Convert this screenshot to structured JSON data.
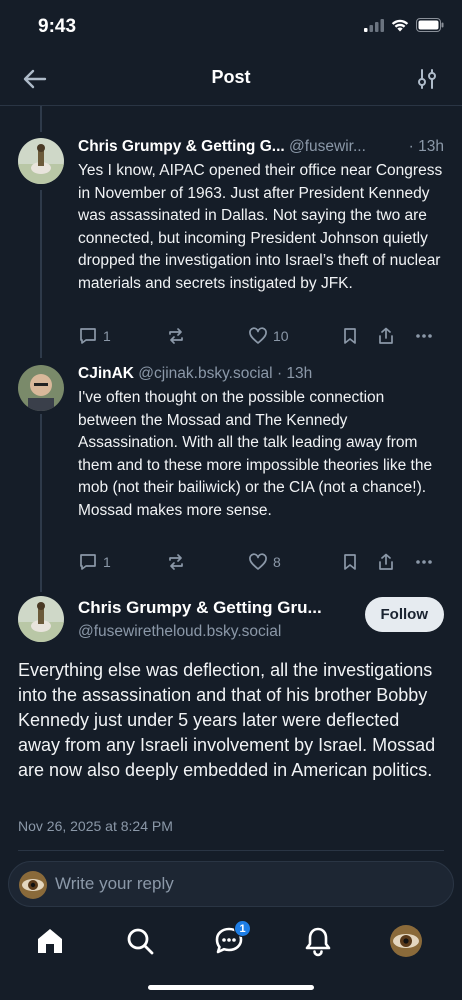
{
  "status": {
    "time": "9:43"
  },
  "header": {
    "title": "Post"
  },
  "replies": [
    {
      "name": "Chris Grumpy & Getting G...",
      "handle": "@fusewir...",
      "time": "· 13h",
      "text": "Yes I know, AIPAC opened their office near Congress in November of 1963. Just after President Kennedy was assassinated in Dallas. Not saying the two are connected, but incoming President Johnson quietly dropped the investigation into Israel’s theft of nuclear materials and secrets instigated by JFK.",
      "reply_count": "1",
      "repost_count": "",
      "like_count": "10"
    },
    {
      "name": "CJinAK",
      "handle": "@cjinak.bsky.social",
      "time": "· 13h",
      "text": "I've often thought on the possible connection between the Mossad and The Kennedy Assassination. With all the talk leading away from them and to these more impossible theories like the mob (not their bailiwick) or the CIA (not a chance!). Mossad makes more sense.",
      "reply_count": "1",
      "repost_count": "",
      "like_count": "8"
    }
  ],
  "main_post": {
    "name": "Chris Grumpy & Getting Gru...",
    "handle": "@fusewiretheloud.bsky.social",
    "follow_label": "Follow",
    "text": "Everything else was deflection, all the investigations into the assassination and that of his brother  Bobby Kennedy just under 5 years later were deflected away from any Israeli involvement by Israel. Mossad are now also deeply embedded in American politics.",
    "date": "Nov 26, 2025 at 8:24 PM"
  },
  "reply_bar": {
    "placeholder": "Write your reply"
  },
  "tabs": {
    "chat_badge": "1"
  },
  "colors": {
    "background": "#151d28",
    "accent": "#1e7ee6",
    "muted": "#8b98a8"
  }
}
